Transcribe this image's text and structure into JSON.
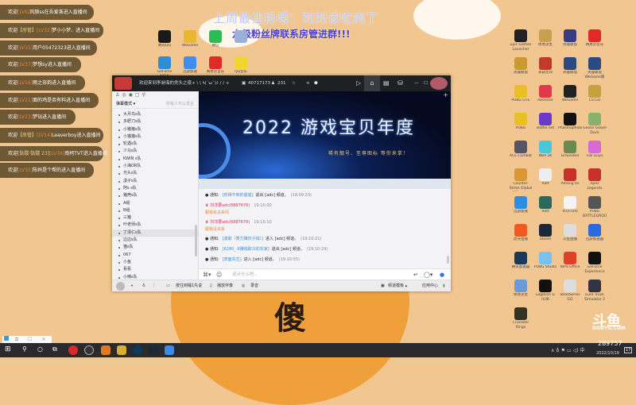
{
  "overlay": {
    "headline": "上周最佳投喂：刘刘该吃肉了",
    "subline": "六级粉丝牌联系房管进群!!!",
    "welcome_messages": [
      {
        "pre": "欢迎",
        "role": "",
        "lv": "[LV6]",
        "name": "风狼ss在吾爱谁",
        "post": "进入直播间"
      },
      {
        "pre": "欢迎",
        "role": "【房管】",
        "lv": "[LV32]",
        "name": "梦小小梦、",
        "post": "进入直播间"
      },
      {
        "pre": "欢迎",
        "role": "",
        "lv": "[LV15]",
        "name": "用户05472323",
        "post": "进入直播间"
      },
      {
        "pre": "欢迎",
        "role": "",
        "lv": "[LV37]",
        "name": "梦想sy",
        "post": "进入直播间"
      },
      {
        "pre": "欢迎",
        "role": "",
        "lv": "[LV16]",
        "name": "雨之奈韵",
        "post": "进入直播间"
      },
      {
        "pre": "欢迎",
        "role": "",
        "lv": "[LV21]",
        "name": "面的鸡是否有料",
        "post": "进入直播间"
      },
      {
        "pre": "欢迎",
        "role": "",
        "lv": "[LV23]",
        "name": "梦钻",
        "post": "进入直播间"
      },
      {
        "pre": "欢迎",
        "role": "【房管】",
        "lv": "[LV14]",
        "name": "Leaverboy",
        "post": "进入直播间"
      },
      {
        "pre": "欢迎",
        "role": "[骷髅·骷髅 23]",
        "lv": "[LV36]",
        "name": "南柯TVT",
        "post": "进入直播间"
      },
      {
        "pre": "欢迎",
        "role": "",
        "lv": "[LV35]",
        "name": "陈妈是个帮的",
        "post": "进入直播间"
      }
    ]
  },
  "desktop_top_icons": [
    {
      "label": "腾讯QQ",
      "color": "#1a1a1a"
    },
    {
      "label": "WeGame",
      "color": "#e8b730"
    },
    {
      "label": "微信",
      "color": "#2dbb55"
    },
    {
      "label": "",
      "color": "#9ab0d8"
    },
    {
      "label": "GeForce NOW",
      "color": "#2a8fd6"
    },
    {
      "label": "迅游加速",
      "color": "#3a8ff0"
    },
    {
      "label": "网易云音乐",
      "color": "#e02a2a"
    },
    {
      "label": "QQ音乐",
      "color": "#f2d62a"
    }
  ],
  "desktop_right_icons": [
    {
      "label": "Epic Games Launcher",
      "color": "#222"
    },
    {
      "label": "绝地求生",
      "color": "#c8a050"
    },
    {
      "label": "英雄联盟",
      "color": "#3a3a80"
    },
    {
      "label": "网易云音乐",
      "color": "#e02a2a"
    },
    {
      "label": "英雄联盟",
      "color": "#c89a30"
    },
    {
      "label": "永劫无间",
      "color": "#c23a2a"
    },
    {
      "label": "英雄联盟",
      "color": "#2a4a80"
    },
    {
      "label": "英雄联盟 WeGame版",
      "color": "#2a4a80"
    },
    {
      "label": "PUBG LITE",
      "color": "#e8c020"
    },
    {
      "label": "Rockstar",
      "color": "#e03a4a"
    },
    {
      "label": "WeGame",
      "color": "#222"
    },
    {
      "label": "CS:GO",
      "color": "#c8a040"
    },
    {
      "label": "PUBG",
      "color": "#e8c020"
    },
    {
      "label": "Battle.net",
      "color": "#6a3ac8"
    },
    {
      "label": "Phasmophobia",
      "color": "#111"
    },
    {
      "label": "Goose Goose Duck",
      "color": "#8ab070"
    },
    {
      "label": "ACE Combat",
      "color": "#556"
    },
    {
      "label": "NBA 2K",
      "color": "#4ac8d8"
    },
    {
      "label": "Grounded",
      "color": "#6a8a50"
    },
    {
      "label": "Fall Guys",
      "color": "#d86ad8"
    },
    {
      "label": "Counter-Strike Global Offensive",
      "color": "#d89a30"
    },
    {
      "label": "Raft",
      "color": "#eee"
    },
    {
      "label": "Among Us",
      "color": "#c8302a"
    },
    {
      "label": "Apex Legends",
      "color": "#c8302a"
    },
    {
      "label": "迅游加速",
      "color": "#2a8fe0"
    },
    {
      "label": "Raft",
      "color": "#2a6a5a"
    },
    {
      "label": "Vice Info",
      "color": "#f4f4f4"
    },
    {
      "label": "PUBG BATTLEGROUNDS",
      "color": "#555"
    },
    {
      "label": "虎牙直播",
      "color": "#f05a20"
    },
    {
      "label": "Steam",
      "color": "#1b2838"
    },
    {
      "label": "斗鱼直播",
      "color": "#ddd"
    },
    {
      "label": "迅游加速器",
      "color": "#2a6ae0"
    },
    {
      "label": "腾讯加速器",
      "color": "#1a3a5a"
    },
    {
      "label": "PUBG Studio",
      "color": "#7ac0f0"
    },
    {
      "label": "WPS Office",
      "color": "#e0402a"
    },
    {
      "label": "GeForce Experience",
      "color": "#111"
    },
    {
      "label": "绝地求生",
      "color": "#6a9ad8"
    },
    {
      "label": "Logitech G HUB",
      "color": "#111"
    },
    {
      "label": "SteelSeries GG",
      "color": "#ddd"
    },
    {
      "label": "Euro Truck Simulator 2",
      "color": "#334"
    },
    {
      "label": "Crusader Kings",
      "color": "#332"
    }
  ],
  "window": {
    "title": "欢迎来到李昶海的秃头之夜+ \\ \\ ٩(´ω`)۶ / / +",
    "room_id": "40717173",
    "viewers": "231",
    "left_tabs_mode": "弹幕模式 ▾",
    "left_speak_rule": "所有人可以发言",
    "channels": [
      "大月鸟s队",
      "多肥刀s队",
      "小猪猪s队",
      "小猫猫s队",
      "轮遇s队",
      "少马s队",
      "KWIN s队",
      "小海OR队",
      "光头s队",
      "漾子s队",
      "阿s s队",
      "猪壳s队",
      "A组",
      "B组",
      "三猪",
      "叶老师s队",
      "丁泽仁s队",
      "边边s队",
      "猫s队",
      "067",
      "小鱼",
      "看看",
      "小楠s队"
    ],
    "selected_channel": "丁泽仁s队",
    "banner": {
      "title": "2022 游戏宝贝年度",
      "subtitle": "稀有靓号、至尊图标 等你来拿！"
    },
    "chat": [
      {
        "type": "notice",
        "prefix": "通知:",
        "name": "[你得不到的爸爸]",
        "action": "退出 [adc] 频道。",
        "time": "(19:09:33)"
      },
      {
        "type": "user",
        "name": "刘洋要adc(8887676)",
        "time": "19:10:00",
        "text": "跟我有关系吗"
      },
      {
        "type": "user",
        "name": "刘洋要adc(8887676)",
        "time": "19:10:10",
        "text": "跟我没关系"
      },
      {
        "type": "notice",
        "prefix": "通知:",
        "name": "[波歌（努力赚份子钱）]",
        "action": "进入 [adc] 频道。",
        "time": "(19:10:21)"
      },
      {
        "type": "notice",
        "prefix": "通知:",
        "name": "[6280_-6赚钱取冷的东家]",
        "action": "退出 [adc] 频道。",
        "time": "(19:10:29)"
      },
      {
        "type": "notice",
        "prefix": "通知:",
        "name": "[表面先生]",
        "action": "进入 [adc] 频道。",
        "time": "(19:10:55)"
      }
    ],
    "input_placeholder": "说点什么吧...",
    "bottom": {
      "ptt": "按住到睡1先说",
      "accompany": "播放伴奏",
      "record": "录音",
      "template": "频道模板 ▴",
      "apps": "应用中心"
    }
  },
  "watermark": {
    "brand": "斗鱼",
    "site": "DOUYU.COM",
    "room": "289757"
  },
  "big_char": "傻",
  "taskbar": {
    "date": "2022/10/19",
    "notif_count": "17"
  }
}
